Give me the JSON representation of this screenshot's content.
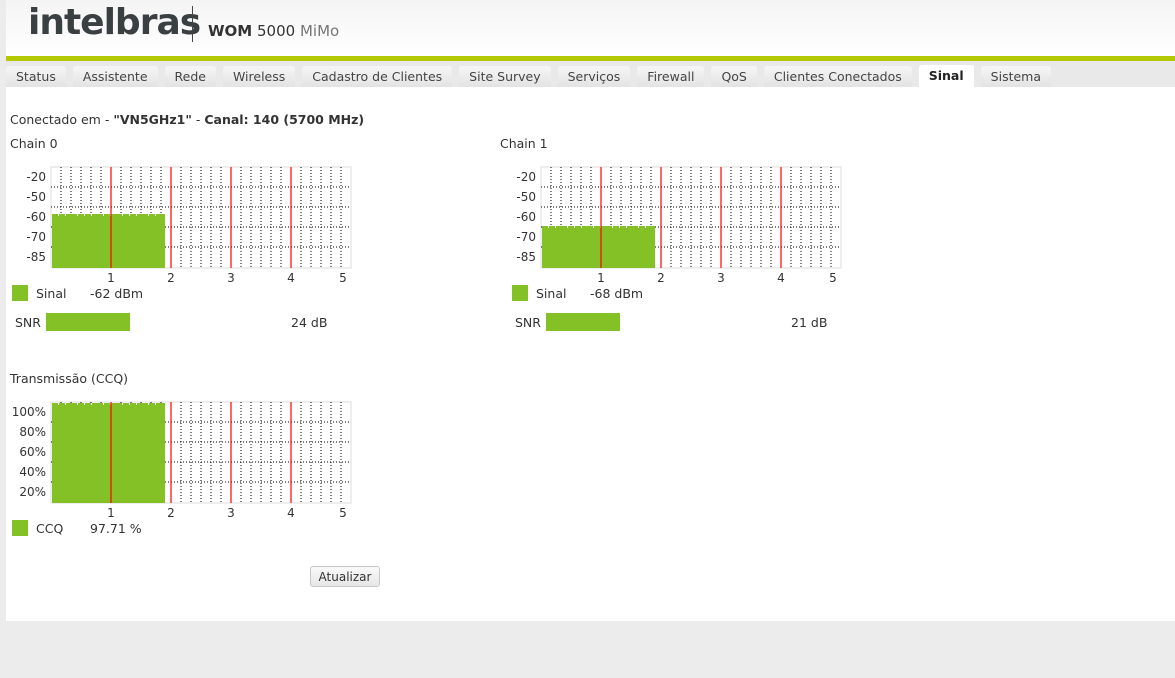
{
  "header": {
    "logo": "intelbras",
    "model_bold": "WOM",
    "model_num": "5000",
    "model_suffix": "MiMo"
  },
  "tabs": [
    {
      "label": "Status"
    },
    {
      "label": "Assistente"
    },
    {
      "label": "Rede"
    },
    {
      "label": "Wireless"
    },
    {
      "label": "Cadastro de Clientes"
    },
    {
      "label": "Site Survey"
    },
    {
      "label": "Serviços"
    },
    {
      "label": "Firewall"
    },
    {
      "label": "QoS"
    },
    {
      "label": "Clientes Conectados"
    },
    {
      "label": "Sinal",
      "active": true
    },
    {
      "label": "Sistema"
    }
  ],
  "connection": {
    "prefix": "Conectado em - ",
    "ssid": "\"VN5GHz1\"",
    "sep": " - ",
    "channel": "Canal: 140 (5700 MHz)"
  },
  "colors": {
    "accent": "#b5c900",
    "bar": "#84c127",
    "marker": "#ff0000"
  },
  "chart_data": [
    {
      "type": "area",
      "title": "Chain 0",
      "y_ticks": [
        "-20",
        "-50",
        "-60",
        "-70",
        "-85"
      ],
      "x_ticks": [
        "1",
        "2",
        "3",
        "4",
        "5"
      ],
      "xlim": [
        0,
        5
      ],
      "data_extent": [
        0,
        1.9
      ],
      "value": -62,
      "legend": "Sinal",
      "value_label": "-62 dBm",
      "snr_label": "SNR",
      "snr": 24,
      "snr_text": "24 dB"
    },
    {
      "type": "area",
      "title": "Chain 1",
      "y_ticks": [
        "-20",
        "-50",
        "-60",
        "-70",
        "-85"
      ],
      "x_ticks": [
        "1",
        "2",
        "3",
        "4",
        "5"
      ],
      "xlim": [
        0,
        5
      ],
      "data_extent": [
        0,
        1.9
      ],
      "value": -68,
      "legend": "Sinal",
      "value_label": "-68 dBm",
      "snr_label": "SNR",
      "snr": 21,
      "snr_text": "21 dB"
    },
    {
      "type": "area",
      "title": "Transmissão (CCQ)",
      "y_ticks": [
        "100%",
        "80%",
        "60%",
        "40%",
        "20%"
      ],
      "x_ticks": [
        "1",
        "2",
        "3",
        "4",
        "5"
      ],
      "xlim": [
        0,
        5
      ],
      "data_extent": [
        0,
        1.9
      ],
      "value": 97.71,
      "legend": "CCQ",
      "value_label": "97.71 %"
    }
  ],
  "buttons": {
    "refresh": "Atualizar"
  }
}
